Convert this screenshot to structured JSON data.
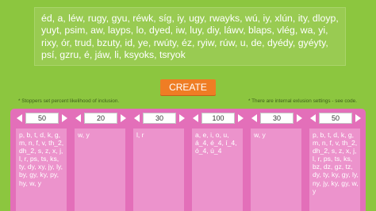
{
  "output_text": "éd, a, léw, rugy, gyu, réwk, síg, iy, ugy, rwayks, wú, iy, xlún, ity, dloyp, yuyt, psim, aw, layps, lo, dyed, iw, luy, diy, láwv, blaps, vlég, wa, yi, rixy, ór, trud, bzuty, id, ye, rwúty, éz, ryiw, rúw, u, de, dyédy, gyéyty, psí, gzru, é, jáw, li, ksyoks, tsryok",
  "create_label": "CREATE",
  "note_left": "* Stoppers set percent likelihood of inclusion.",
  "note_right": "* There are internal exlusion settings - see code.",
  "columns": [
    {
      "value": "50",
      "text": "p, b, t, d, k, g, m, n, f, v, th_2, dh_2, s, z, x, j, l, r, ps, ts, ks, ty, dy, xy, jy, ly, by, gy, ky, py, hy, w, y"
    },
    {
      "value": "20",
      "text": "w, y"
    },
    {
      "value": "30",
      "text": "l, r"
    },
    {
      "value": "100",
      "text": "a, e, i, o, u, á_4, é_4, í_4, ó_4, ú_4"
    },
    {
      "value": "30",
      "text": "w, y"
    },
    {
      "value": "50",
      "text": "p, b, t, d, k, g, m, n, f, v, th_2, dh_2, s, z, x, j, l, r, ps, ts, ks, bz, dz, gz, tz, dy, ty, ky, gy, ly, ny, jy, ky, gy, w, y"
    }
  ]
}
